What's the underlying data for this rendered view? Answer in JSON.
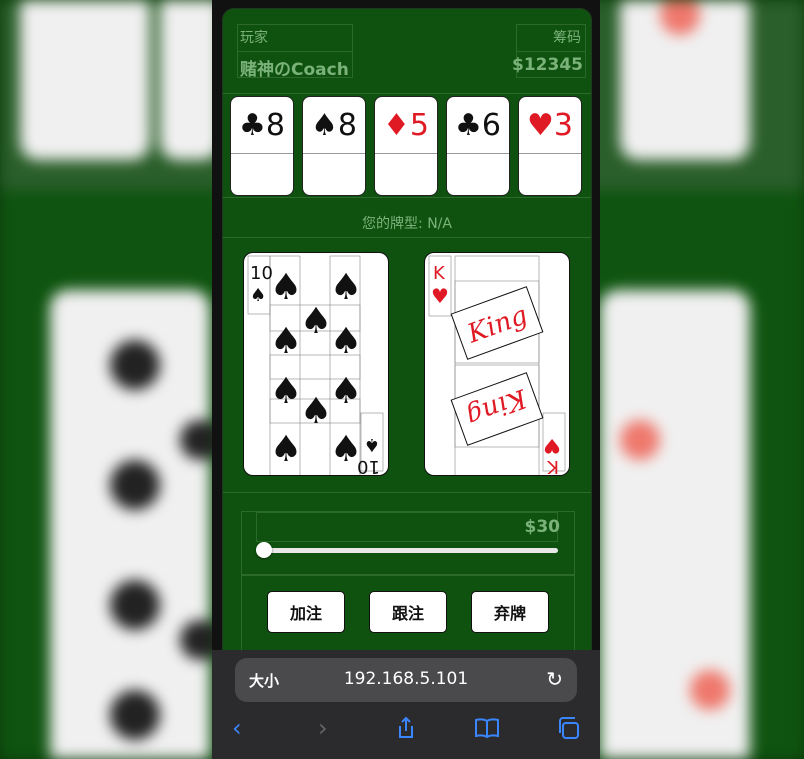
{
  "player": {
    "label": "玩家",
    "name": "赌神のCoach"
  },
  "chips": {
    "label": "筹码",
    "amount": "$12345"
  },
  "community_cards": [
    {
      "suit": "♣",
      "rank": "8",
      "color": "#111111"
    },
    {
      "suit": "♠",
      "rank": "8",
      "color": "#111111"
    },
    {
      "suit": "♦",
      "rank": "5",
      "color": "#e01a24"
    },
    {
      "suit": "♣",
      "rank": "6",
      "color": "#111111"
    },
    {
      "suit": "♥",
      "rank": "3",
      "color": "#e01a24"
    }
  ],
  "hand_type": "您的牌型: N/A",
  "hand": [
    {
      "rank": "10",
      "suit": "♠",
      "color": "#111111"
    },
    {
      "rank": "K",
      "suit": "♥",
      "color": "#e01a24",
      "script": "King"
    }
  ],
  "bet": {
    "amount": "$30",
    "level": 0
  },
  "actions": {
    "raise": "加注",
    "call": "跟注",
    "fold": "弃牌"
  },
  "browser": {
    "text_size": "大小",
    "url": "192.168.5.101"
  },
  "colors": {
    "table_green": "#0f520f",
    "label_green": "#7ab27a",
    "link_blue": "#3a86ff"
  }
}
